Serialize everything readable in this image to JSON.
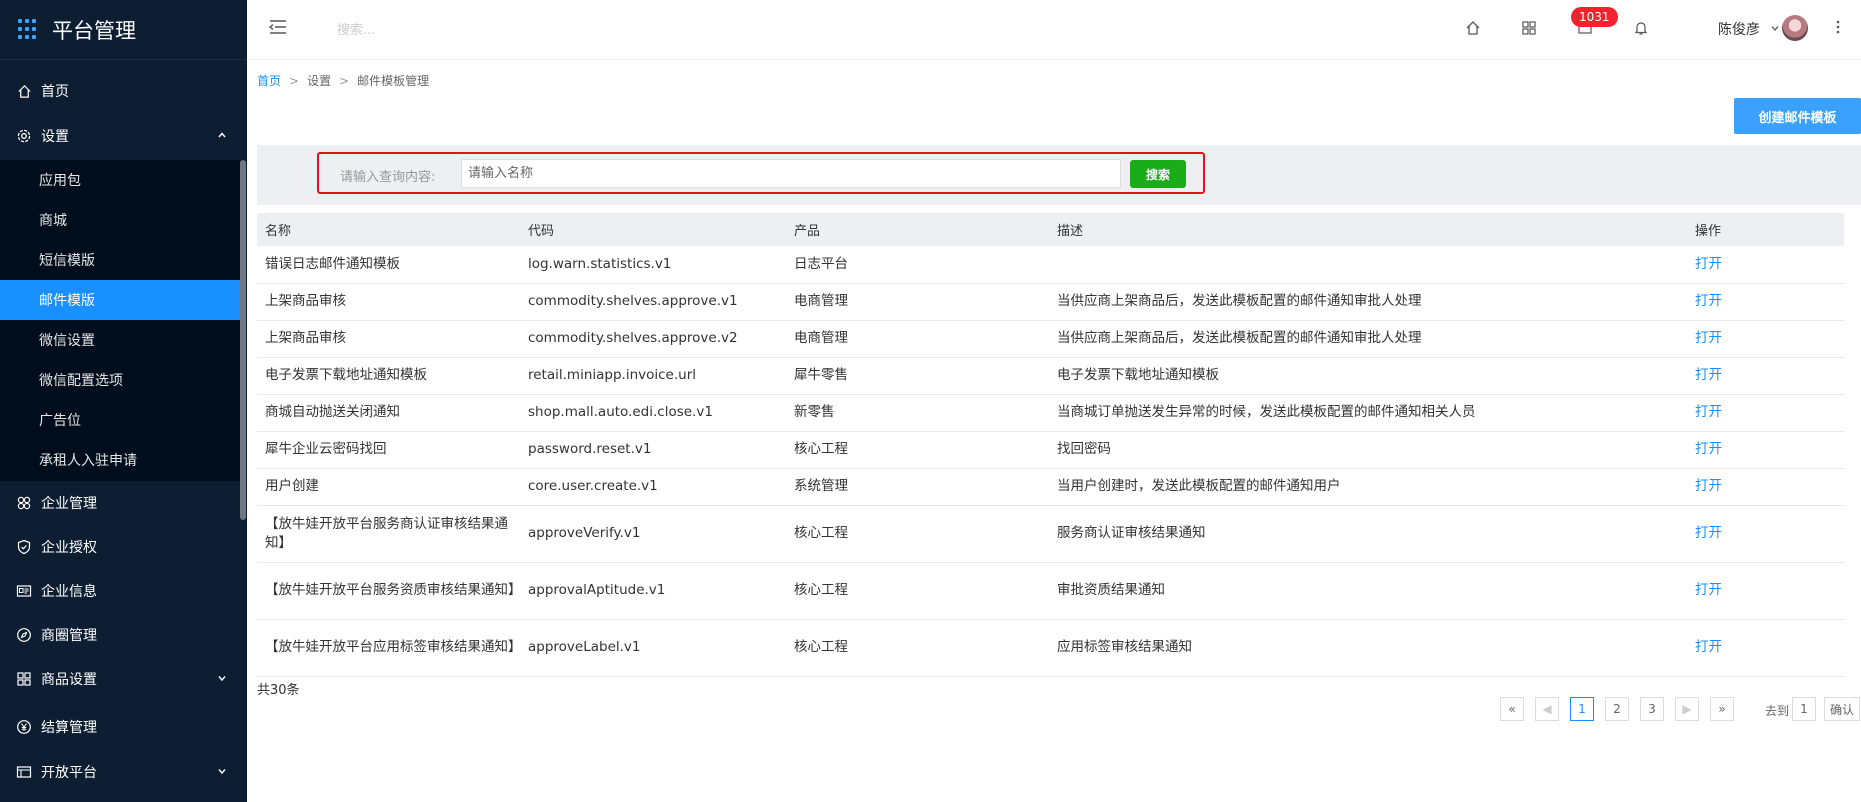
{
  "app": {
    "title": "平台管理"
  },
  "sidebar": {
    "items": [
      {
        "label": "首页",
        "icon": "home-icon"
      },
      {
        "label": "设置",
        "icon": "gear-icon",
        "expanded": true
      },
      {
        "label": "企业管理",
        "icon": "enterprise-icon"
      },
      {
        "label": "企业授权",
        "icon": "shield-icon"
      },
      {
        "label": "企业信息",
        "icon": "id-card-icon"
      },
      {
        "label": "商圈管理",
        "icon": "compass-icon"
      },
      {
        "label": "商品设置",
        "icon": "grid-icon"
      },
      {
        "label": "结算管理",
        "icon": "yen-icon"
      },
      {
        "label": "开放平台",
        "icon": "open-platform-icon"
      }
    ],
    "settings_sub": [
      {
        "label": "应用包"
      },
      {
        "label": "商城"
      },
      {
        "label": "短信模版"
      },
      {
        "label": "邮件模版",
        "active": true
      },
      {
        "label": "微信设置"
      },
      {
        "label": "微信配置选项"
      },
      {
        "label": "广告位"
      },
      {
        "label": "承租人入驻申请"
      }
    ]
  },
  "header": {
    "search_placeholder": "搜索...",
    "badge_count": "1031",
    "username": "陈俊彦"
  },
  "breadcrumb": {
    "home": "首页",
    "level2": "设置",
    "current": "邮件模板管理"
  },
  "actions": {
    "create_label": "创建邮件模板"
  },
  "query": {
    "label": "请输入查询内容:",
    "placeholder": "请输入名称",
    "search_label": "搜索"
  },
  "table": {
    "headers": {
      "name": "名称",
      "code": "代码",
      "product": "产品",
      "desc": "描述",
      "op": "操作"
    },
    "rows": [
      {
        "name": "错误日志邮件通知模板",
        "code": "log.warn.statistics.v1",
        "product": "日志平台",
        "desc": "",
        "op": "打开"
      },
      {
        "name": "上架商品审核",
        "code": "commodity.shelves.approve.v1",
        "product": "电商管理",
        "desc": "当供应商上架商品后，发送此模板配置的邮件通知审批人处理",
        "op": "打开"
      },
      {
        "name": "上架商品审核",
        "code": "commodity.shelves.approve.v2",
        "product": "电商管理",
        "desc": "当供应商上架商品后，发送此模板配置的邮件通知审批人处理",
        "op": "打开"
      },
      {
        "name": "电子发票下载地址通知模板",
        "code": "retail.miniapp.invoice.url",
        "product": "犀牛零售",
        "desc": "电子发票下载地址通知模板",
        "op": "打开"
      },
      {
        "name": "商城自动抛送关闭通知",
        "code": "shop.mall.auto.edi.close.v1",
        "product": "新零售",
        "desc": "当商城订单抛送发生异常的时候，发送此模板配置的邮件通知相关人员",
        "op": "打开"
      },
      {
        "name": "犀牛企业云密码找回",
        "code": "password.reset.v1",
        "product": "核心工程",
        "desc": "找回密码",
        "op": "打开"
      },
      {
        "name": "用户创建",
        "code": "core.user.create.v1",
        "product": "系统管理",
        "desc": "当用户创建时，发送此模板配置的邮件通知用户",
        "op": "打开"
      },
      {
        "name": "【放牛娃开放平台服务商认证审核结果通知】",
        "code": "approveVerify.v1",
        "product": "核心工程",
        "desc": "服务商认证审核结果通知",
        "op": "打开"
      },
      {
        "name": "【放牛娃开放平台服务资质审核结果通知】",
        "code": "approvalAptitude.v1",
        "product": "核心工程",
        "desc": "审批资质结果通知",
        "op": "打开"
      },
      {
        "name": "【放牛娃开放平台应用标签审核结果通知】",
        "code": "approveLabel.v1",
        "product": "核心工程",
        "desc": "应用标签审核结果通知",
        "op": "打开"
      }
    ]
  },
  "pagination": {
    "total": "共30条",
    "first": "«",
    "prev": "◀",
    "pages": [
      "1",
      "2",
      "3"
    ],
    "next": "▶",
    "last": "»",
    "current": "1",
    "goto_label": "去到",
    "goto_value": "1",
    "confirm": "确认"
  },
  "colors": {
    "sidebar_bg": "#0d1e33",
    "accent": "#1890ff",
    "search_btn": "#1aad19",
    "highlight": "#e5121b",
    "badge": "#f5222d"
  }
}
